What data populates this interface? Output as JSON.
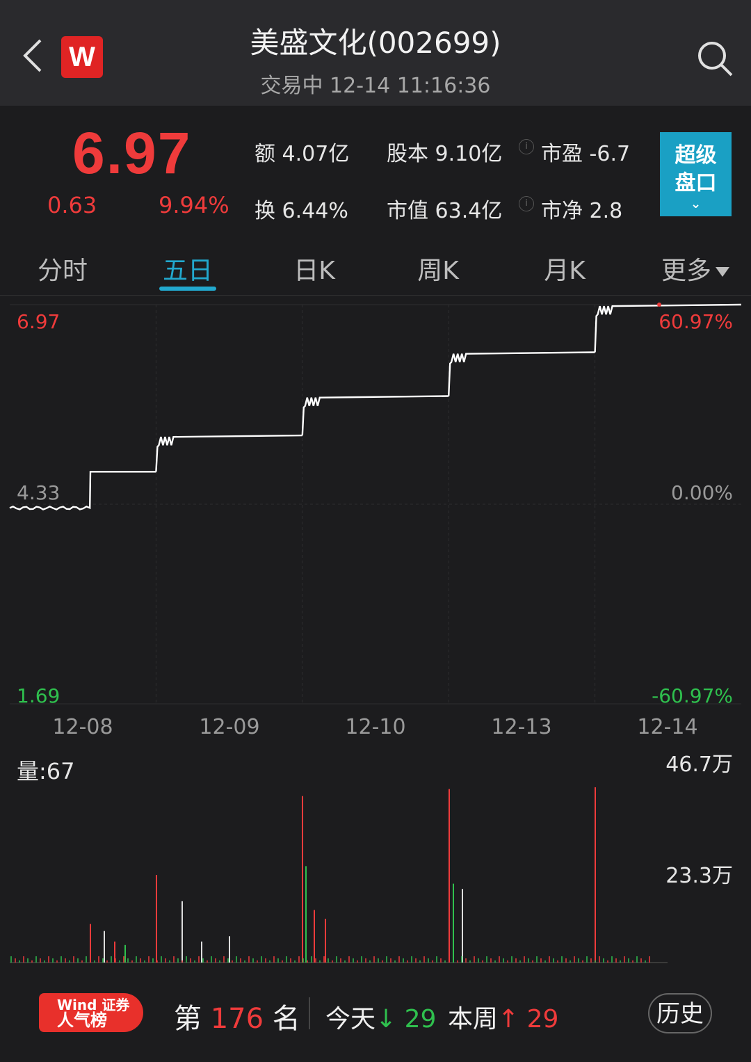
{
  "header": {
    "title": "美盛文化(002699)",
    "subtitle": "交易中 12-14 11:16:36",
    "logo": "W"
  },
  "quote": {
    "price": "6.97",
    "change": "0.63",
    "change_pct": "9.94%",
    "stats": {
      "amount": "额 4.07亿",
      "equity": "股本 9.10亿",
      "pe": "市盈 -6.7",
      "turnover": "换 6.44%",
      "market_cap": "市值 63.4亿",
      "pb": "市净 2.8"
    },
    "super_button": {
      "line1": "超级",
      "line2": "盘口"
    }
  },
  "tabs": [
    "分时",
    "五日",
    "日K",
    "周K",
    "月K",
    "更多"
  ],
  "active_tab": "五日",
  "chart_axes": {
    "y_top_price": "6.97",
    "y_mid_price": "4.33",
    "y_bottom_price": "1.69",
    "y_top_pct": "60.97%",
    "y_mid_pct": "0.00%",
    "y_bottom_pct": "-60.97%",
    "dates": [
      "12-08",
      "12-09",
      "12-10",
      "12-13",
      "12-14"
    ],
    "volume_label": "量:67",
    "volume_max": "46.7万",
    "volume_mid": "23.3万"
  },
  "chart_data": {
    "type": "line",
    "x": [
      "12-08",
      "12-09",
      "12-10",
      "12-13",
      "12-14"
    ],
    "series": [
      {
        "values": [
          4.76,
          5.24,
          5.76,
          6.34,
          6.97
        ]
      }
    ],
    "ylim": [
      1.69,
      6.97
    ],
    "volume_max": 467000,
    "colors": {
      "up": "#ef3b3b",
      "down": "#2fc04e",
      "line": "#ffffff"
    }
  },
  "footer": {
    "badge_line1": "Wind 证券",
    "badge_line2": "人气榜",
    "rank_prefix": "第",
    "rank_num": "176",
    "rank_suffix": "名",
    "today_label": "今天",
    "today_value": "29",
    "week_label": "本周",
    "week_value": "29",
    "history": "历史"
  }
}
